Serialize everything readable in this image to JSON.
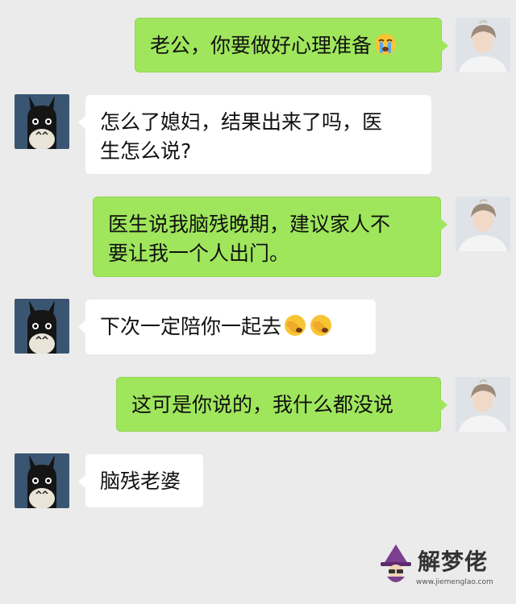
{
  "messages": [
    {
      "side": "right",
      "text": "老公，你要做好心理准备",
      "emoji": [
        "crying-face-icon"
      ]
    },
    {
      "side": "left",
      "line1": "怎么了媳妇，结果出来了吗，医",
      "line2": "生怎么说?"
    },
    {
      "side": "right",
      "line1": "医生说我脑残晚期，建议家人不",
      "line2": "要让我一个人出门。"
    },
    {
      "side": "left",
      "text": "下次一定陪你一起去",
      "emoji": [
        "facepalm-icon",
        "facepalm-icon"
      ]
    },
    {
      "side": "right",
      "text": "这可是你说的，我什么都没说"
    },
    {
      "side": "left",
      "text": "脑残老婆"
    }
  ],
  "watermark": {
    "title": "解梦佬",
    "url": "www.jiemenglao.com"
  },
  "colors": {
    "background": "#ebebeb",
    "sent_bubble": "#9fe65c",
    "received_bubble": "#ffffff"
  }
}
